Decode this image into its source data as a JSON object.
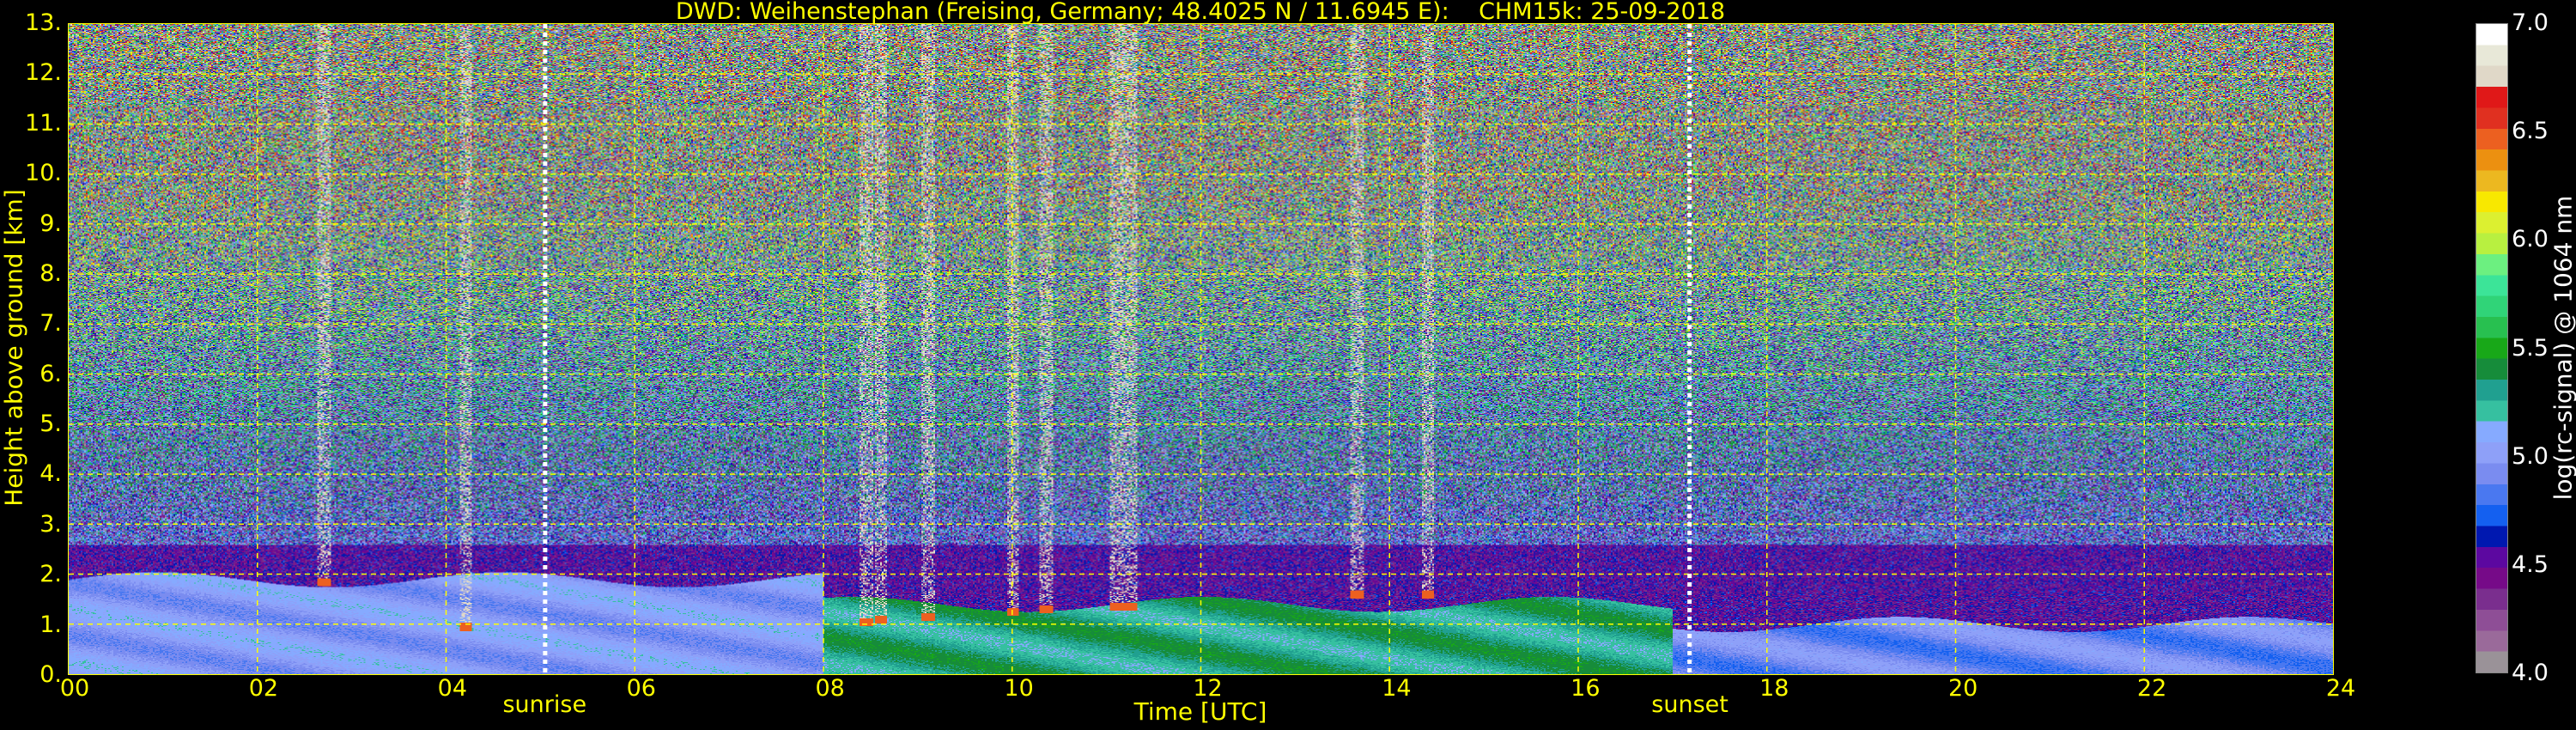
{
  "chart_data": {
    "type": "heatmap",
    "title": "DWD: Weihenstephan (Freising, Germany; 48.4025 N / 11.6945 E):    CHM15k: 25-09-2018",
    "xlabel": "Time [UTC]",
    "ylabel": "Height above ground [km]",
    "xlim": [
      0,
      24
    ],
    "ylim": [
      0,
      13
    ],
    "x_ticks": [
      0,
      2,
      4,
      6,
      8,
      10,
      12,
      14,
      16,
      18,
      20,
      22,
      24
    ],
    "x_tick_labels": [
      "00",
      "02",
      "04",
      "06",
      "08",
      "10",
      "12",
      "14",
      "16",
      "18",
      "20",
      "22",
      "24"
    ],
    "y_ticks": [
      0,
      1,
      2,
      3,
      4,
      5,
      6,
      7,
      8,
      9,
      10,
      11,
      12,
      13
    ],
    "y_tick_labels": [
      "0.",
      "1.",
      "2.",
      "3.",
      "4.",
      "5.",
      "6.",
      "7.",
      "8.",
      "9.",
      "10.",
      "11.",
      "12.",
      "13."
    ],
    "grid": true,
    "annotations": [
      {
        "label": "sunrise",
        "time": 5.05
      },
      {
        "label": "sunset",
        "time": 17.18
      }
    ],
    "colorbar": {
      "label": "log(rc-signal) @ 1064 nm",
      "range": [
        4.0,
        7.0
      ],
      "ticks": [
        4.0,
        4.5,
        5.0,
        5.5,
        6.0,
        6.5,
        7.0
      ],
      "tick_labels": [
        "4.0",
        "4.5",
        "5.0",
        "5.5",
        "6.0",
        "6.5",
        "7.0"
      ],
      "colors": [
        "#9a9298",
        "#9a6a9a",
        "#8e4e96",
        "#7a2e8e",
        "#760a88",
        "#5c08a0",
        "#0018b0",
        "#1460f0",
        "#4a78f0",
        "#7a8cf0",
        "#8ea0f8",
        "#86aaff",
        "#36c0a0",
        "#20a090",
        "#168c3a",
        "#18a818",
        "#28c050",
        "#30d478",
        "#3ce498",
        "#6cf080",
        "#b8f040",
        "#dcf030",
        "#f8e800",
        "#ecb820",
        "#ec9010",
        "#ec6020",
        "#e03020",
        "#e01818",
        "#e0d8c8",
        "#e8e8d8",
        "#ffffff"
      ]
    },
    "layers": [
      {
        "name": "boundary-layer-night",
        "t_start": 0,
        "t_end": 8,
        "top_km": 1.9,
        "log_signal": 5.0
      },
      {
        "name": "boundary-layer-day",
        "t_start": 8,
        "t_end": 17,
        "top_km": 1.4,
        "log_signal": 5.3
      },
      {
        "name": "boundary-layer-evening",
        "t_start": 17,
        "t_end": 24,
        "top_km": 1.0,
        "log_signal": 4.9
      }
    ],
    "clouds": [
      {
        "t": 2.7,
        "base_km": 1.85
      },
      {
        "t": 4.2,
        "base_km": 0.95
      },
      {
        "t": 8.45,
        "base_km": 1.05
      },
      {
        "t": 8.6,
        "base_km": 1.1
      },
      {
        "t": 9.1,
        "base_km": 1.15
      },
      {
        "t": 10.0,
        "base_km": 1.25
      },
      {
        "t": 10.35,
        "base_km": 1.3
      },
      {
        "t": 11.1,
        "base_km": 1.35
      },
      {
        "t": 11.25,
        "base_km": 1.35
      },
      {
        "t": 13.65,
        "base_km": 1.6
      },
      {
        "t": 14.4,
        "base_km": 1.6
      }
    ]
  }
}
